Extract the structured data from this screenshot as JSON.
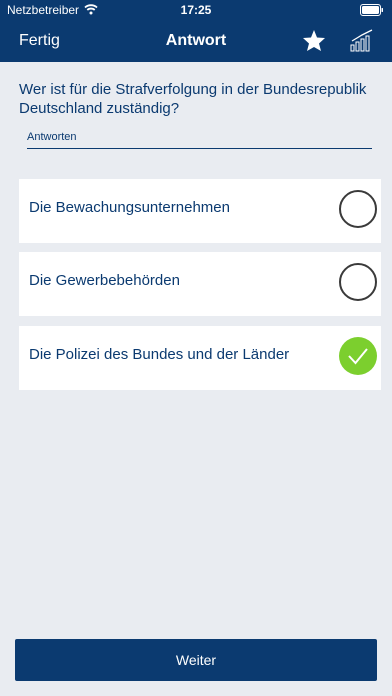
{
  "status": {
    "carrier": "Netzbetreiber",
    "time": "17:25"
  },
  "nav": {
    "left_label": "Fertig",
    "title": "Antwort",
    "icons": [
      "star-icon",
      "stats-icon"
    ]
  },
  "question": {
    "text": "Wer ist für die Strafverfolgung in der Bundesrepublik Deutschland zuständig?"
  },
  "answers_label": "Antworten",
  "options": [
    {
      "label": "Die Bewachungsunternehmen",
      "selected": false
    },
    {
      "label": "Die Gewerbebehörden",
      "selected": false
    },
    {
      "label": "Die Polizei des Bundes und der Länder",
      "selected": true
    }
  ],
  "footer": {
    "next_label": "Weiter"
  },
  "colors": {
    "primary": "#0b3a70",
    "background": "#e9ecf1",
    "correct": "#7ccf2e"
  }
}
